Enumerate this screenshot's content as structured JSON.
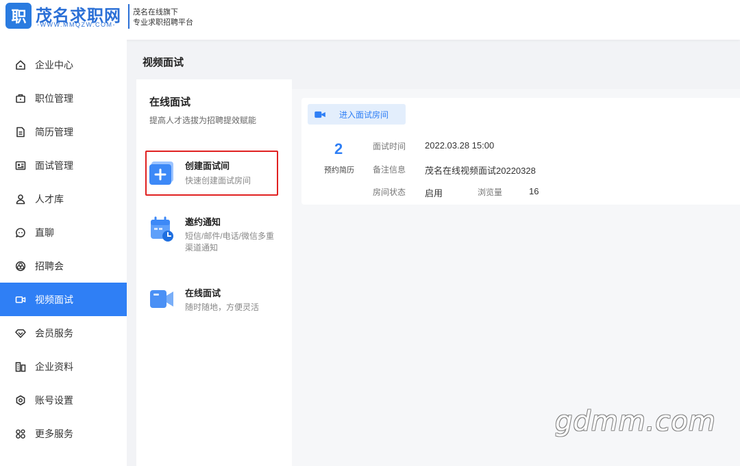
{
  "header": {
    "logo_badge": "职",
    "logo_title": "茂名求职网",
    "logo_url": "-WWW.MMQZW.COM-",
    "tagline_1": "茂名在线旗下",
    "tagline_2": "专业求职招聘平台"
  },
  "sidebar": {
    "items": [
      {
        "label": "企业中心",
        "icon": "home-icon"
      },
      {
        "label": "职位管理",
        "icon": "briefcase-icon"
      },
      {
        "label": "简历管理",
        "icon": "document-icon"
      },
      {
        "label": "面试管理",
        "icon": "id-card-icon"
      },
      {
        "label": "人才库",
        "icon": "user-icon"
      },
      {
        "label": "直聊",
        "icon": "chat-icon"
      },
      {
        "label": "招聘会",
        "icon": "aperture-icon"
      },
      {
        "label": "视频面试",
        "icon": "video-icon",
        "active": true
      },
      {
        "label": "会员服务",
        "icon": "diamond-icon"
      },
      {
        "label": "企业资料",
        "icon": "building-icon"
      },
      {
        "label": "账号设置",
        "icon": "settings-icon"
      },
      {
        "label": "更多服务",
        "icon": "more-services-icon"
      }
    ]
  },
  "main": {
    "page_title": "视频面试",
    "panel_title": "在线面试",
    "panel_subtitle": "提高人才选拔为招聘提效赋能",
    "features": [
      {
        "title": "创建面试间",
        "desc": "快速创建面试房间",
        "icon": "add-room-icon"
      },
      {
        "title": "邀约通知",
        "desc": "短信/邮件/电话/微信多重渠道通知",
        "icon": "calendar-clock-icon"
      },
      {
        "title": "在线面试",
        "desc": "随时随地，方便灵活",
        "icon": "video-camera-icon"
      }
    ]
  },
  "room": {
    "enter_label": "进入面试房间",
    "count": "2",
    "count_label": "预约简历",
    "time_key": "面试时间",
    "time_val": "2022.03.28 15:00",
    "note_key": "备注信息",
    "note_val": "茂名在线视频面试20220328",
    "status_key": "房间状态",
    "status_val": "启用",
    "views_key": "浏览量",
    "views_val": "16"
  },
  "watermark": "gdmm.com",
  "colors": {
    "accent": "#2f7ff5",
    "highlight_border": "#e02020",
    "brand": "#2a6fd6"
  }
}
